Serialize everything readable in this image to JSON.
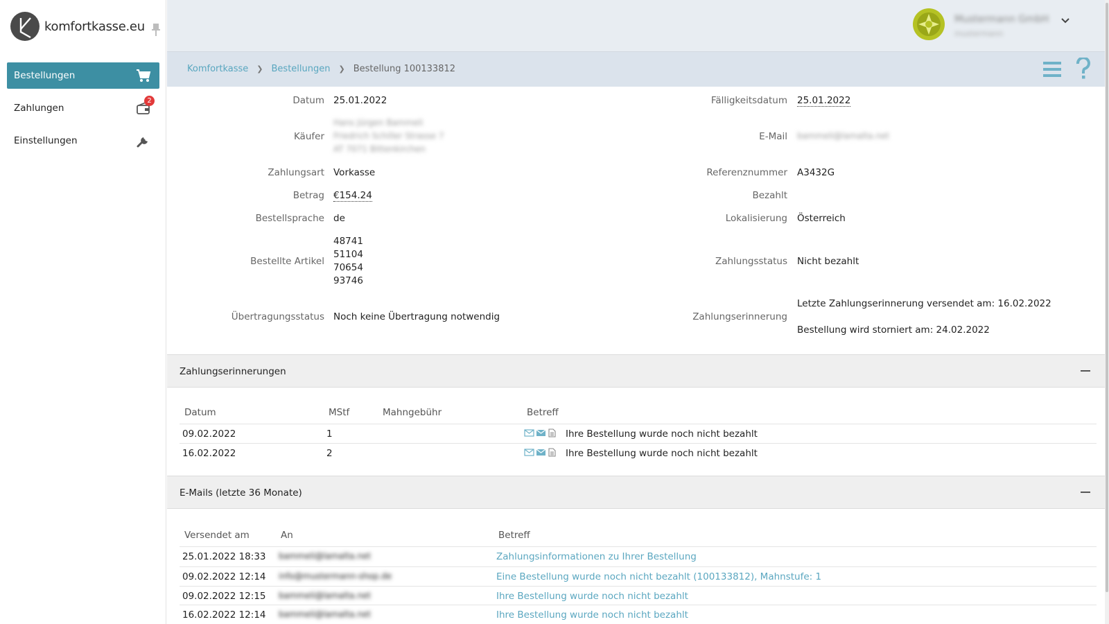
{
  "app": {
    "brand": "komfortkasse.eu"
  },
  "sidebar": {
    "items": [
      {
        "label": "Bestellungen",
        "icon": "cart-icon",
        "active": true
      },
      {
        "label": "Zahlungen",
        "icon": "wallet-icon",
        "badge": "2"
      },
      {
        "label": "Einstellungen",
        "icon": "wrench-icon"
      }
    ]
  },
  "header": {
    "company_name": "Mustermann GmbH",
    "company_sub": "mustermann"
  },
  "breadcrumb": {
    "items": [
      "Komfortkasse",
      "Bestellungen"
    ],
    "current": "Bestellung 100133812"
  },
  "details": {
    "left": [
      {
        "label": "Datum",
        "value": "25.01.2022"
      },
      {
        "label": "Käufer",
        "lines": [
          "Hans Jürgen Bammeli",
          "Friedrich Schiller Strasse 7",
          "AT 7071 Bittenkirchen"
        ]
      },
      {
        "label": "Zahlungsart",
        "value": "Vorkasse"
      },
      {
        "label": "Betrag",
        "value": "€154.24"
      },
      {
        "label": "Bestellsprache",
        "value": "de"
      },
      {
        "label": "Bestellte Artikel",
        "lines": [
          "48741",
          "51104",
          "70654",
          "93746"
        ]
      },
      {
        "label": "Übertragungsstatus",
        "value": "Noch keine Übertragung notwendig"
      }
    ],
    "right": [
      {
        "label": "Fälligkeitsdatum",
        "value": "25.01.2022"
      },
      {
        "label": "E-Mail",
        "value": "bammeli@lamalta.net"
      },
      {
        "label": "Referenznummer",
        "value": "A3432G"
      },
      {
        "label": "Bezahlt",
        "value": ""
      },
      {
        "label": "Lokalisierung",
        "value": "Österreich"
      },
      {
        "label": "Zahlungsstatus",
        "value": "Nicht bezahlt"
      },
      {
        "label": "Zahlungserinnerung",
        "lines": [
          "Letzte Zahlungserinnerung versendet am: 16.02.2022",
          "Bestellung wird storniert am: 24.02.2022"
        ]
      }
    ]
  },
  "reminders": {
    "title": "Zahlungserinnerungen",
    "columns": [
      "Datum",
      "MStf",
      "Mahngebühr",
      "Betreff"
    ],
    "rows": [
      {
        "datum": "09.02.2022",
        "mstf": "1",
        "fee": "",
        "betreff": "Ihre Bestellung wurde noch nicht bezahlt"
      },
      {
        "datum": "16.02.2022",
        "mstf": "2",
        "fee": "",
        "betreff": "Ihre Bestellung wurde noch nicht bezahlt"
      }
    ]
  },
  "emails": {
    "title": "E-Mails (letzte 36 Monate)",
    "columns": [
      "Versendet am",
      "An",
      "Betreff"
    ],
    "rows": [
      {
        "sent": "25.01.2022 18:33",
        "to": "bammeli@lamalta.net",
        "subject": "Zahlungsinformationen zu Ihrer Bestellung"
      },
      {
        "sent": "09.02.2022 12:14",
        "to": "info@mustermann-shop.de",
        "subject": "Eine Bestellung wurde noch nicht bezahlt (100133812), Mahnstufe: 1"
      },
      {
        "sent": "09.02.2022 12:15",
        "to": "bammeli@lamalta.net",
        "subject": "Ihre Bestellung wurde noch nicht bezahlt"
      },
      {
        "sent": "16.02.2022 12:14",
        "to": "bammeli@lamalta.net",
        "subject": "Ihre Bestellung wurde noch nicht bezahlt"
      }
    ]
  },
  "colors": {
    "accent": "#3d8fa3",
    "link": "#58a6bf",
    "badge": "#e23a3a",
    "topbar": "#e8edf2",
    "crumbbar": "#dbe3ec"
  }
}
